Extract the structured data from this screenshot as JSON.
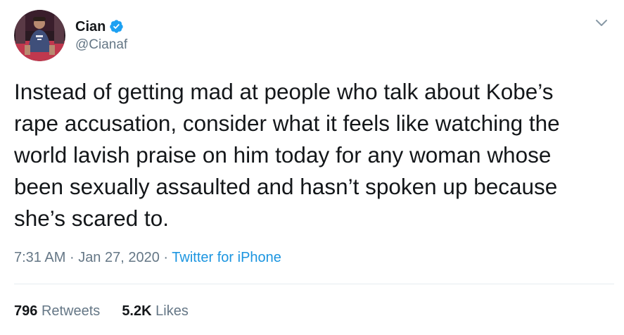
{
  "author": {
    "display_name": "Cian",
    "handle": "@Cianaf",
    "verified": true,
    "avatar_icon": "user-photo-avatar"
  },
  "tweet": {
    "text": "Instead of getting mad at people who talk about Kobe’s\nrape accusation, consider what it feels like watching the\nworld lavish praise on him today for any woman whose\nbeen sexually assaulted and hasn’t spoken up because\nshe’s scared to.",
    "time": "7:31 AM",
    "date": "Jan 27, 2020",
    "separator": "·",
    "source": "Twitter for iPhone"
  },
  "stats": {
    "retweets_count": "796",
    "retweets_label": "Retweets",
    "likes_count": "5.2K",
    "likes_label": "Likes"
  },
  "colors": {
    "text": "#14171a",
    "secondary": "#657786",
    "link": "#1b95e0",
    "verified": "#1da1f2",
    "divider": "#e6ecf0"
  },
  "icons": {
    "verified": "verified-badge-icon",
    "menu": "chevron-down-icon"
  }
}
